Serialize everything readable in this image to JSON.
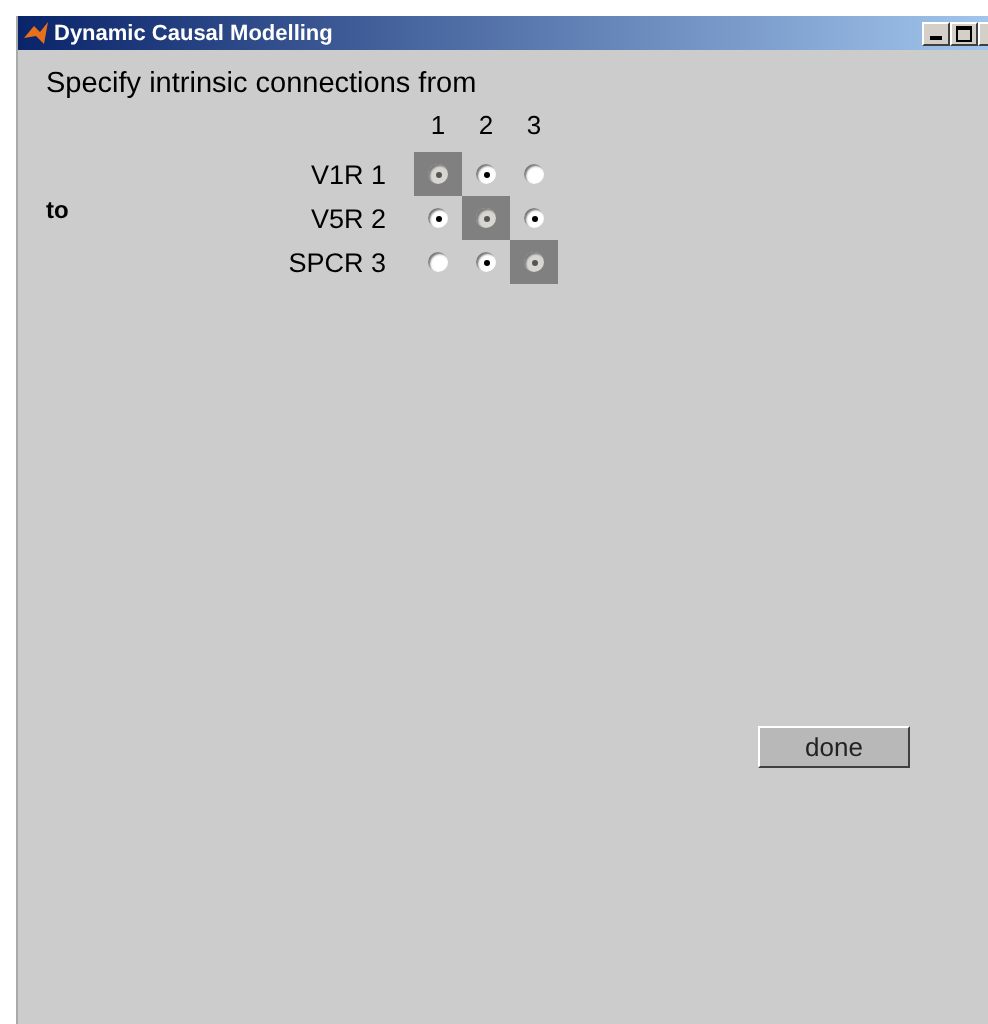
{
  "window": {
    "title": "Dynamic Causal Modelling"
  },
  "heading": "Specify intrinsic connections from",
  "to_label": "to",
  "columns": [
    "1",
    "2",
    "3"
  ],
  "rows": [
    {
      "label": "V1R 1",
      "cells": [
        {
          "checked": true,
          "disabled": true
        },
        {
          "checked": true,
          "disabled": false
        },
        {
          "checked": false,
          "disabled": false
        }
      ]
    },
    {
      "label": "V5R 2",
      "cells": [
        {
          "checked": true,
          "disabled": false
        },
        {
          "checked": true,
          "disabled": true
        },
        {
          "checked": true,
          "disabled": false
        }
      ]
    },
    {
      "label": "SPCR 3",
      "cells": [
        {
          "checked": false,
          "disabled": false
        },
        {
          "checked": true,
          "disabled": false
        },
        {
          "checked": true,
          "disabled": true
        }
      ]
    }
  ],
  "buttons": [
    "done"
  ]
}
